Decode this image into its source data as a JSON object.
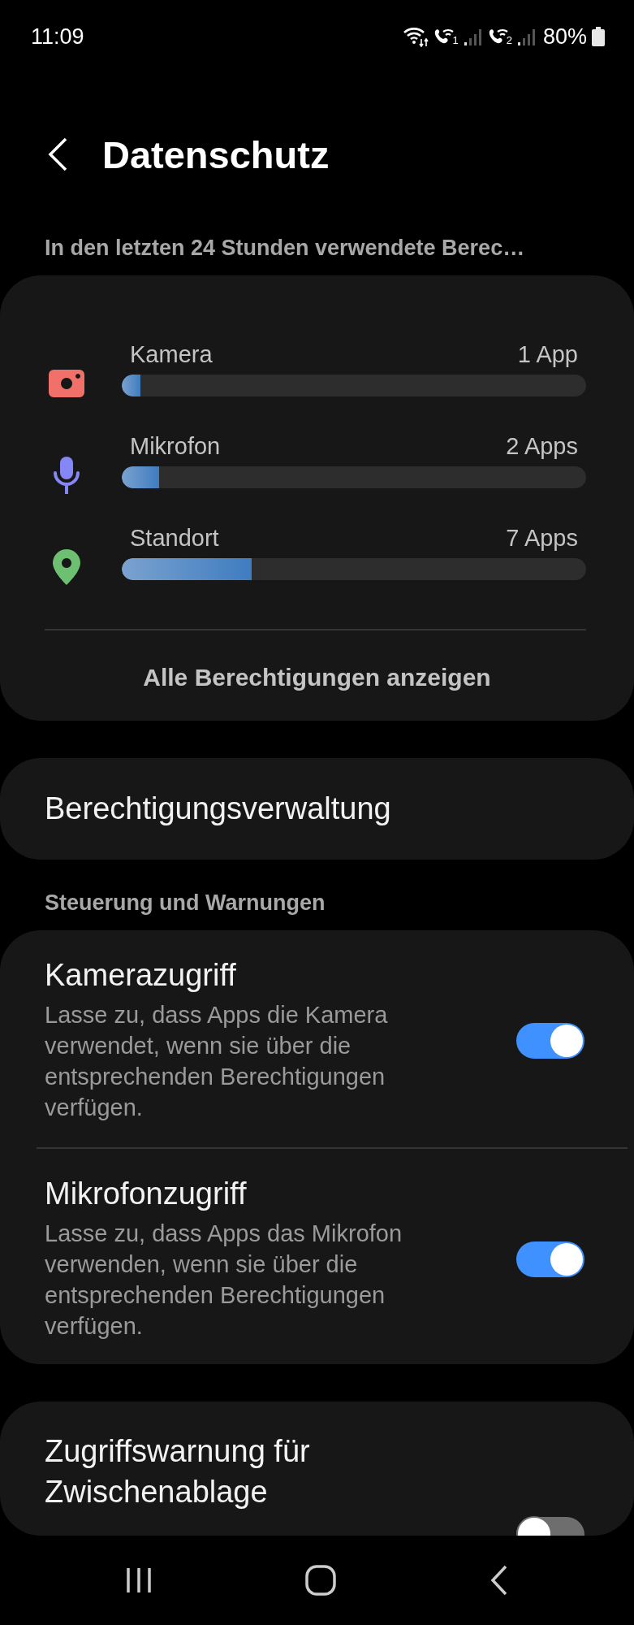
{
  "status_bar": {
    "time": "11:09",
    "sim_1": "1",
    "sim_2": "2",
    "battery": "80%"
  },
  "header": {
    "title": "Datenschutz"
  },
  "usage": {
    "heading": "In den letzten 24 Stunden verwendete Berec…",
    "items": [
      {
        "kind": "camera",
        "color": "#f2706a",
        "label": "Kamera",
        "count": "1 App",
        "level": 0.04
      },
      {
        "kind": "microphone",
        "color": "#8487f5",
        "label": "Mikrofon",
        "count": "2 Apps",
        "level": 0.08
      },
      {
        "kind": "location",
        "color": "#6dc072",
        "label": "Standort",
        "count": "7 Apps",
        "level": 0.28
      }
    ],
    "link": "Alle Berechtigungen anzeigen"
  },
  "manager": {
    "label": "Berechtigungsverwaltung"
  },
  "controls": {
    "heading": "Steuerung und Warnungen",
    "items": [
      {
        "title": "Kamerazugriff",
        "description": "Lasse zu, dass Apps die Kamera verwendet, wenn sie über die entsprechenden Berechtigungen verfügen.",
        "on": true
      },
      {
        "title": "Mikrofonzugriff",
        "description": "Lasse zu, dass Apps das Mikrofon verwenden, wenn sie über die entsprechenden Berechtigungen verfügen.",
        "on": true
      }
    ]
  },
  "clipboard": {
    "title": "Zugriffswarnung für Zwischenablage",
    "on": false
  }
}
